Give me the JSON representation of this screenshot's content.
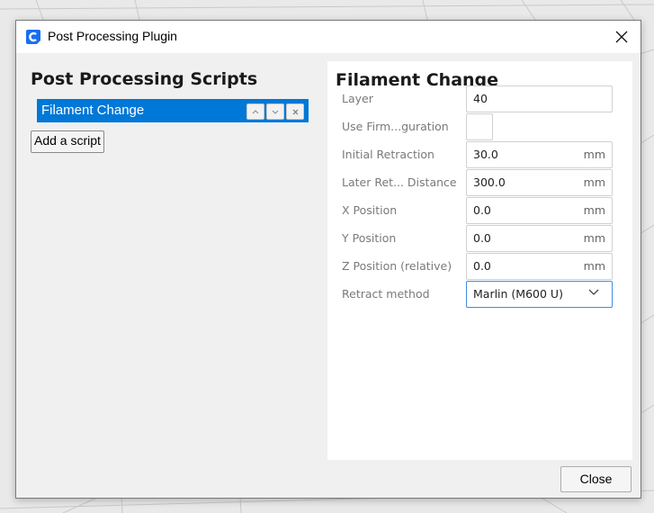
{
  "window": {
    "title": "Post Processing Plugin",
    "icon": "cura-logo-icon",
    "close_icon": "close-icon"
  },
  "left": {
    "title": "Post Processing Scripts",
    "scripts": [
      {
        "label": "Filament Change",
        "selected": true
      }
    ],
    "item_buttons": {
      "up": "˄",
      "down": "˅",
      "remove": "×"
    },
    "add_button": "Add a script"
  },
  "right": {
    "title": "Filament Change",
    "settings": [
      {
        "label": "Layer",
        "type": "text",
        "value": "40",
        "unit": ""
      },
      {
        "label": "Use Firm...guration",
        "type": "checkbox",
        "checked": false
      },
      {
        "label": "Initial Retraction",
        "type": "number",
        "value": "30.0",
        "unit": "mm"
      },
      {
        "label": "Later Ret... Distance",
        "type": "number",
        "value": "300.0",
        "unit": "mm"
      },
      {
        "label": "X Position",
        "type": "number",
        "value": "0.0",
        "unit": "mm"
      },
      {
        "label": "Y Position",
        "type": "number",
        "value": "0.0",
        "unit": "mm"
      },
      {
        "label": "Z Position (relative)",
        "type": "number",
        "value": "0.0",
        "unit": "mm"
      },
      {
        "label": "Retract method",
        "type": "select",
        "value": "Marlin (M600 U)"
      }
    ]
  },
  "footer": {
    "close_button": "Close"
  },
  "colors": {
    "selection": "#0078d7",
    "focus_border": "#3d8ee0"
  }
}
